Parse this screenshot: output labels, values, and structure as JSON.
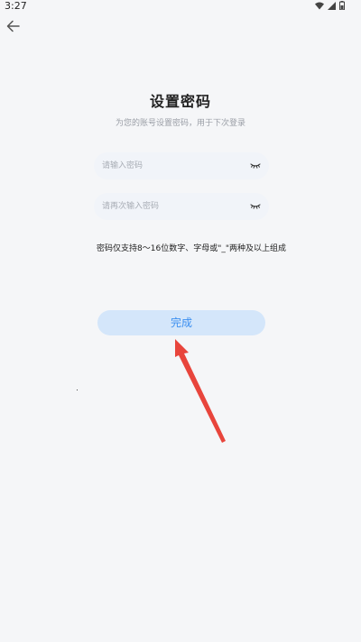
{
  "status_bar": {
    "time": "3:27",
    "icons": [
      "wifi-icon",
      "signal-icon",
      "battery-icon"
    ]
  },
  "header": {
    "back_icon": "arrow-left-icon"
  },
  "main": {
    "title": "设置密码",
    "subtitle": "为您的账号设置密码，用于下次登录",
    "password_field": {
      "placeholder": "请输入密码",
      "value": "",
      "toggle_icon": "eye-closed-icon"
    },
    "confirm_field": {
      "placeholder": "请再次输入密码",
      "value": "",
      "toggle_icon": "eye-closed-icon"
    },
    "hint": "密码仅支持8～16位数字、字母或\"_\"两种及以上组成",
    "done_label": "完成"
  },
  "colors": {
    "background": "#f5f6f8",
    "input_background": "#f1f4f9",
    "button_background": "#d4e6fa",
    "button_text": "#3a8ef0",
    "annotation_arrow": "#e8453c"
  }
}
